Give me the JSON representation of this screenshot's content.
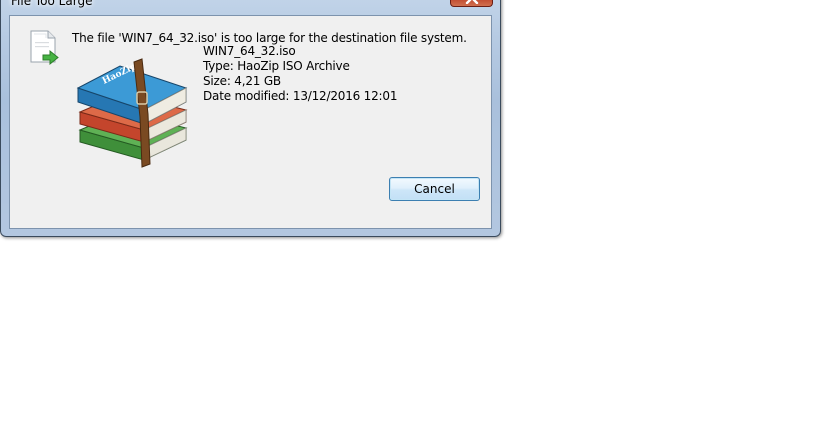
{
  "window": {
    "title": "File Too Large",
    "close_icon": "close-x-icon"
  },
  "dialog": {
    "message": "The file 'WIN7_64_32.iso' is too large for the destination file system.",
    "file_icon": "file-copy-arrow-icon",
    "archive_icon": "haozip-archive-books-icon",
    "archive_brand_text": "HaoZip",
    "details": {
      "name": "WIN7_64_32.iso",
      "type": "Type: HaoZip ISO Archive",
      "size": "Size: 4,21 GB",
      "modified": "Date modified: 13/12/2016 12:01"
    },
    "cancel_label": "Cancel"
  },
  "colors": {
    "client_bg": "#f0f0f0",
    "close_red": "#c0462c",
    "button_border": "#3c7fb1",
    "book_blue": "#2e8fc9",
    "book_red": "#c4452c",
    "book_green": "#3f8f3a",
    "strap_brown": "#7a4a22"
  }
}
